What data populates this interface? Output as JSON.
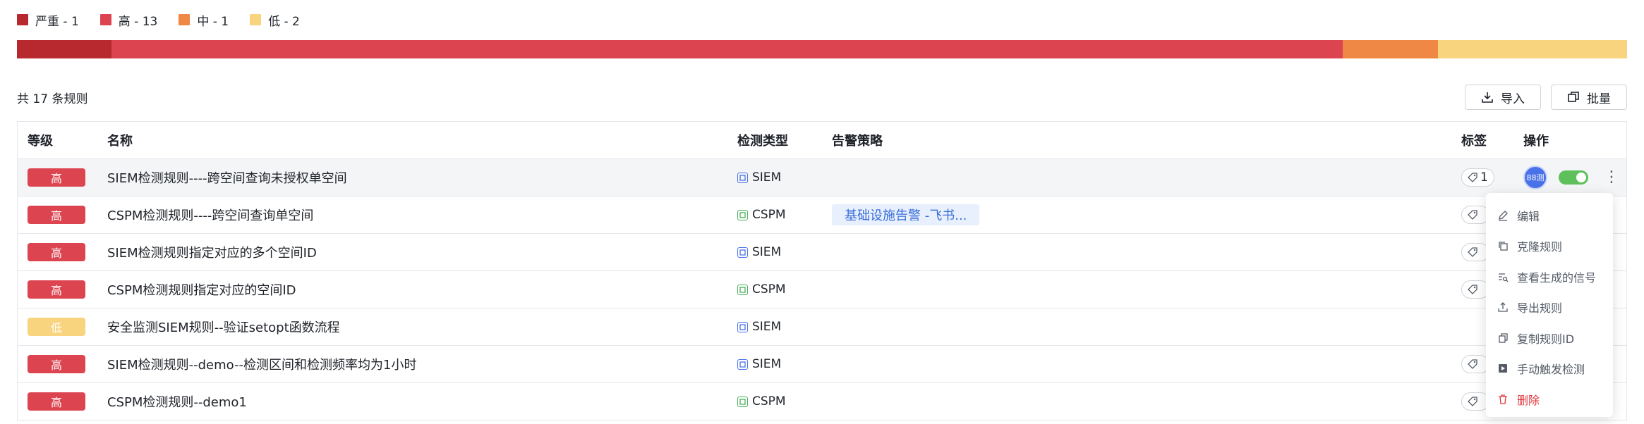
{
  "legend": [
    {
      "label": "严重 - 1",
      "color": "#b8292f"
    },
    {
      "label": "高 - 13",
      "color": "#dc4450"
    },
    {
      "label": "中 - 1",
      "color": "#ef8845"
    },
    {
      "label": "低 - 2",
      "color": "#f8d47f"
    }
  ],
  "severity_counts": [
    {
      "name": "严重",
      "count": 1,
      "color": "#b8292f"
    },
    {
      "name": "高",
      "count": 13,
      "color": "#dc4450"
    },
    {
      "name": "中",
      "count": 1,
      "color": "#ef8845"
    },
    {
      "name": "低",
      "count": 2,
      "color": "#f8d47f"
    }
  ],
  "summary": {
    "count_text": "共 17 条规则"
  },
  "toolbar": {
    "import_label": "导入",
    "batch_label": "批量"
  },
  "table": {
    "headers": {
      "level": "等级",
      "name": "名称",
      "type": "检测类型",
      "policy": "告警策略",
      "tag": "标签",
      "ops": "操作"
    },
    "rows": [
      {
        "level": "高",
        "level_color": "#dc4450",
        "name": "SIEM检测规则----跨空间查询未授权单空间",
        "type": "SIEM",
        "policy": "",
        "tag": "1",
        "avatar": "88测"
      },
      {
        "level": "高",
        "level_color": "#dc4450",
        "name": "CSPM检测规则----跨空间查询单空间",
        "type": "CSPM",
        "policy": "基础设施告警 -飞书...",
        "tag": "",
        "avatar": ""
      },
      {
        "level": "高",
        "level_color": "#dc4450",
        "name": "SIEM检测规则指定对应的多个空间ID",
        "type": "SIEM",
        "policy": "",
        "tag": "",
        "avatar": ""
      },
      {
        "level": "高",
        "level_color": "#dc4450",
        "name": "CSPM检测规则指定对应的空间ID",
        "type": "CSPM",
        "policy": "",
        "tag": "",
        "avatar": ""
      },
      {
        "level": "低",
        "level_color": "#f8d47f",
        "name": "安全监测SIEM规则--验证setopt函数流程",
        "type": "SIEM",
        "policy": "",
        "tag": "",
        "avatar": ""
      },
      {
        "level": "高",
        "level_color": "#dc4450",
        "name": "SIEM检测规则--demo--检测区间和检测频率均为1小时",
        "type": "SIEM",
        "policy": "",
        "tag": "",
        "avatar": ""
      },
      {
        "level": "高",
        "level_color": "#dc4450",
        "name": "CSPM检测规则--demo1",
        "type": "CSPM",
        "policy": "",
        "tag": "",
        "avatar": ""
      }
    ]
  },
  "menu": {
    "items": [
      {
        "label": "编辑",
        "icon": "edit-icon"
      },
      {
        "label": "克隆规则",
        "icon": "clone-icon"
      },
      {
        "label": "查看生成的信号",
        "icon": "signal-search-icon"
      },
      {
        "label": "导出规则",
        "icon": "export-icon"
      },
      {
        "label": "复制规则ID",
        "icon": "copy-icon"
      },
      {
        "label": "手动触发检测",
        "icon": "play-icon"
      },
      {
        "label": "删除",
        "icon": "trash-icon"
      }
    ]
  },
  "colors": {
    "siem": "#4a72e8",
    "cspm": "#4cae5c",
    "policy_bg": "#e8f0fe",
    "toggle_on": "#5ec05a"
  }
}
